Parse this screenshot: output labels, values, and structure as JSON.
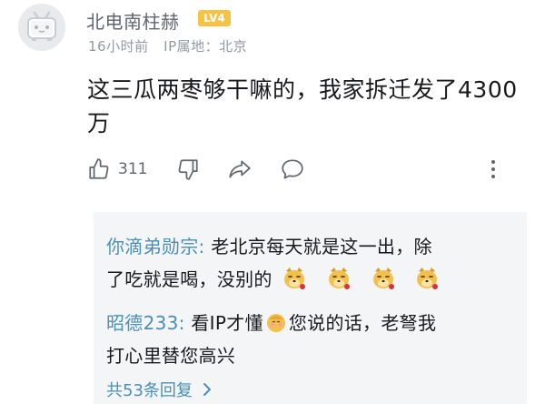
{
  "comment": {
    "username": "北电南柱赫",
    "level": "LV4",
    "time": "16小时前",
    "ip_location": "IP属地：北京",
    "text_line1": "这三瓜两枣够干嘛的，我家拆迁发了4300",
    "text_line2": "万"
  },
  "actions": {
    "like_count": "311"
  },
  "replies": [
    {
      "author": "你滴弟勋宗:",
      "text_line1": " 老北京每天就是这一出，除",
      "text_line2": "了吃就是喝，没别的"
    },
    {
      "author": "昭德233:",
      "text_before_emoji": " 看IP才懂",
      "text_after_emoji": "您说的话，老弩我",
      "text_line2": "打心里替您高兴"
    }
  ],
  "more_replies": "共53条回复",
  "colors": {
    "link_blue": "#4a8fb6",
    "level_badge": "#f6c244",
    "reply_bg": "#f4f5f7",
    "meta_gray": "#9499a0"
  },
  "icons": [
    "avatar-tv-icon",
    "thumbs-up-icon",
    "thumbs-down-icon",
    "share-icon",
    "reply-bubble-icon",
    "more-menu-icon",
    "doge-emote",
    "shy-face-emoji",
    "chevron-right-icon"
  ]
}
